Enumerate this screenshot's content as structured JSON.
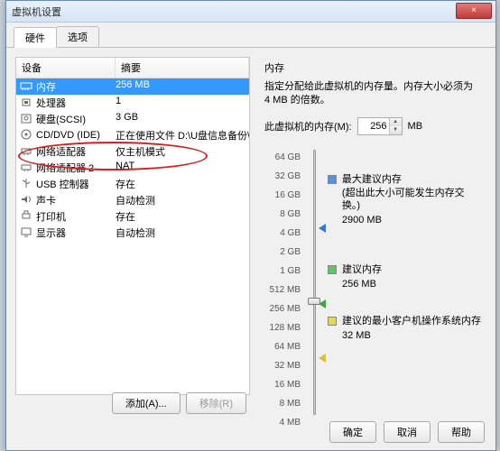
{
  "window": {
    "title": "虚拟机设置",
    "close": "×"
  },
  "tabs": {
    "hardware": "硬件",
    "options": "选项"
  },
  "list": {
    "col_device": "设备",
    "col_summary": "摘要",
    "rows": [
      {
        "device": "内存",
        "summary": "256 MB",
        "icon": "memory",
        "selected": true
      },
      {
        "device": "处理器",
        "summary": "1",
        "icon": "cpu"
      },
      {
        "device": "硬盘(SCSI)",
        "summary": "3 GB",
        "icon": "disk"
      },
      {
        "device": "CD/DVD (IDE)",
        "summary": "正在使用文件 D:\\U盘信息备份\\ 根目...",
        "icon": "cd"
      },
      {
        "device": "网络适配器",
        "summary": "仅主机模式",
        "icon": "net"
      },
      {
        "device": "网络适配器 2",
        "summary": "NAT",
        "icon": "net"
      },
      {
        "device": "USB 控制器",
        "summary": "存在",
        "icon": "usb"
      },
      {
        "device": "声卡",
        "summary": "自动检测",
        "icon": "sound"
      },
      {
        "device": "打印机",
        "summary": "存在",
        "icon": "printer"
      },
      {
        "device": "显示器",
        "summary": "自动检测",
        "icon": "display"
      }
    ]
  },
  "left_buttons": {
    "add": "添加(A)...",
    "remove": "移除(R)"
  },
  "right": {
    "heading": "内存",
    "desc": "指定分配给此虚拟机的内存量。内存大小必须为 4 MB 的倍数。",
    "label": "此虚拟机的内存(M):",
    "value": "256",
    "unit": "MB",
    "ticks": [
      "64 GB",
      "32 GB",
      "16 GB",
      "8 GB",
      "4 GB",
      "2 GB",
      "1 GB",
      "512 MB",
      "256 MB",
      "128 MB",
      "64 MB",
      "32 MB",
      "16 MB",
      "8 MB",
      "4 MB"
    ],
    "legend": {
      "max": {
        "label": "最大建议内存",
        "note": "(超出此大小可能发生内存交换。)",
        "value": "2900 MB"
      },
      "rec": {
        "label": "建议内存",
        "value": "256 MB"
      },
      "min": {
        "label": "建议的最小客户机操作系统内存",
        "value": "32 MB"
      }
    }
  },
  "footer": {
    "ok": "确定",
    "cancel": "取消",
    "help": "帮助"
  }
}
